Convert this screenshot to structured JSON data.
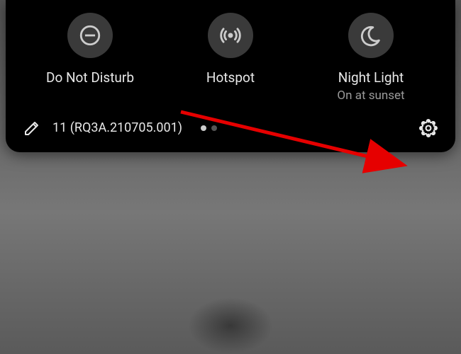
{
  "tiles": [
    {
      "name": "do-not-disturb",
      "label": "Do Not Disturb",
      "sublabel": ""
    },
    {
      "name": "hotspot",
      "label": "Hotspot",
      "sublabel": ""
    },
    {
      "name": "night-light",
      "label": "Night Light",
      "sublabel": "On at sunset"
    }
  ],
  "footer": {
    "build": "11 (RQ3A.210705.001)",
    "page_active": 0,
    "page_count": 2
  },
  "icons": {
    "dnd": "do-not-disturb-icon",
    "hotspot": "hotspot-icon",
    "nightlight": "moon-icon",
    "edit": "pencil-icon",
    "settings": "gear-icon"
  }
}
